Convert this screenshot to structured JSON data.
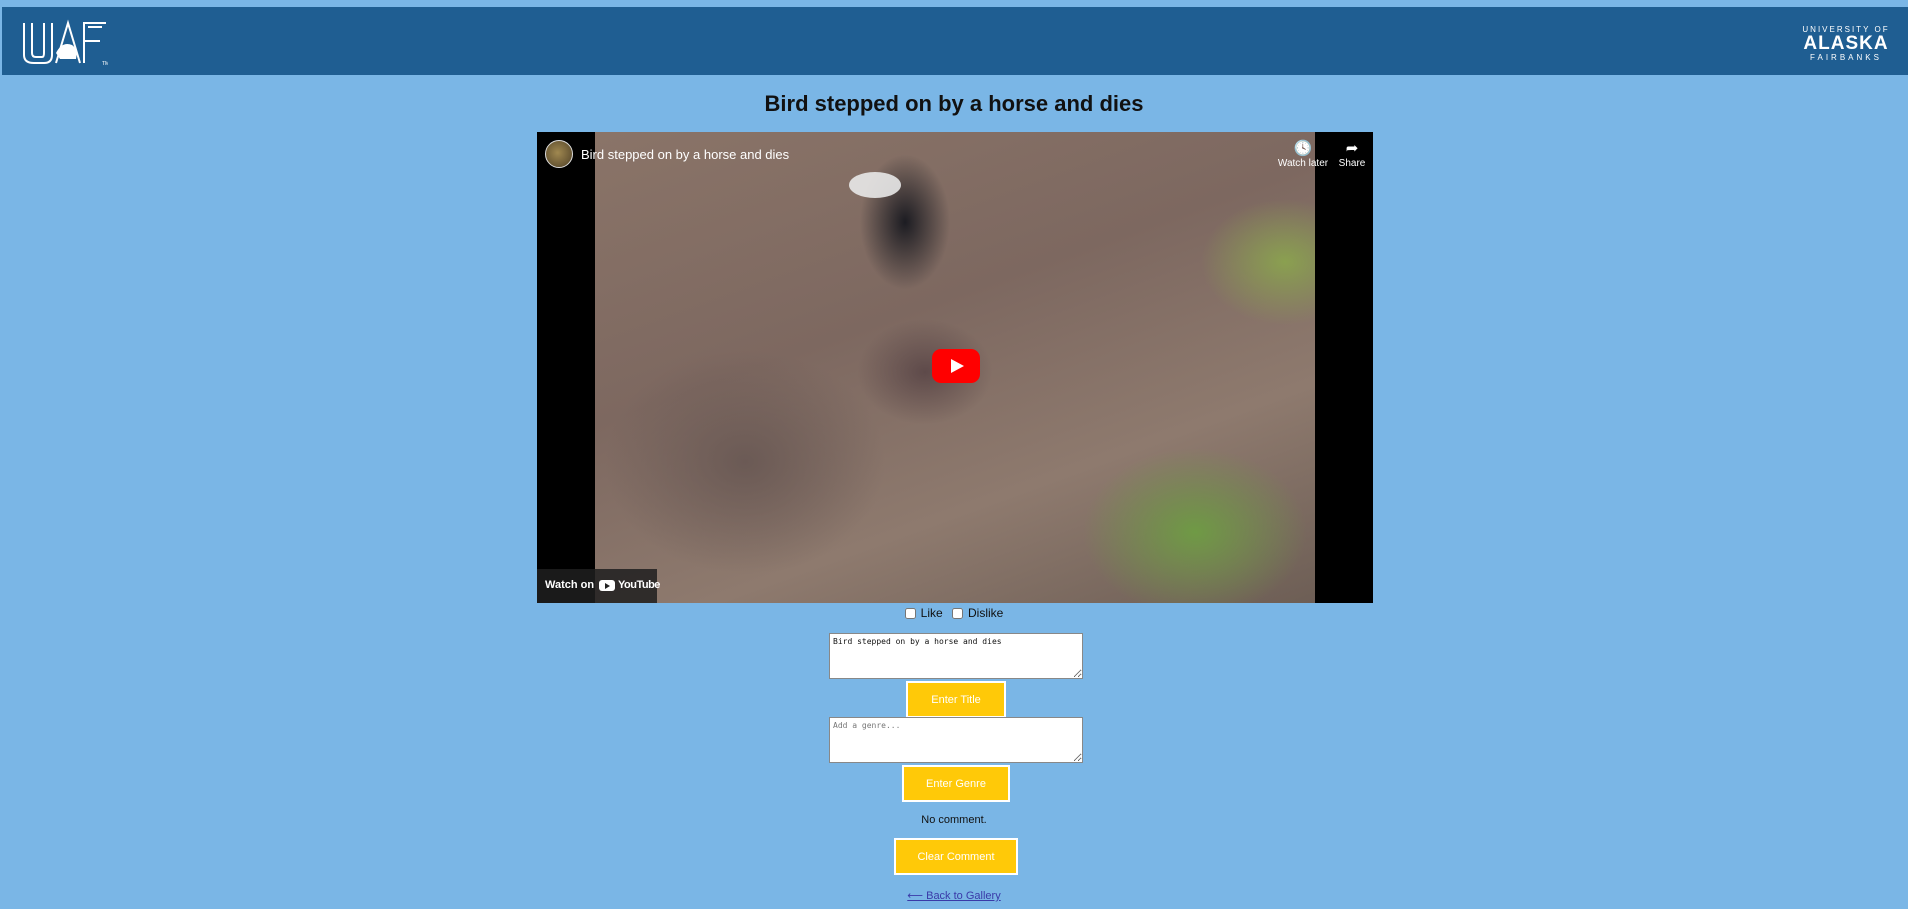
{
  "header": {
    "left_logo_icon": "uaf-nanook-logo-icon",
    "right_logo_lines": [
      "UNIVERSITY OF",
      "ALASKA",
      "FAIRBANKS"
    ]
  },
  "page": {
    "title": "Bird stepped on by a horse and dies"
  },
  "video": {
    "title": "Bird stepped on by a horse and dies",
    "watch_later_label": "Watch later",
    "share_label": "Share",
    "watch_on_label": "Watch on",
    "youtube_label": "YouTube",
    "watch_later_icon": "clock-icon",
    "share_icon": "share-arrow-icon",
    "play_icon": "play-button-icon"
  },
  "reactions": {
    "like_label": "Like",
    "dislike_label": "Dislike",
    "like_checked": false,
    "dislike_checked": false
  },
  "title_form": {
    "value": "Bird stepped on by a horse and dies",
    "button_label": "Enter Title"
  },
  "genre_form": {
    "placeholder": "Add a genre...",
    "button_label": "Enter Genre"
  },
  "comment": {
    "status": "No comment.",
    "clear_label": "Clear Comment"
  },
  "nav": {
    "back_label": "⟵ Back to Gallery"
  },
  "colors": {
    "background": "#7ab6e6",
    "header": "#1f5e92",
    "button": "#ffc908"
  }
}
